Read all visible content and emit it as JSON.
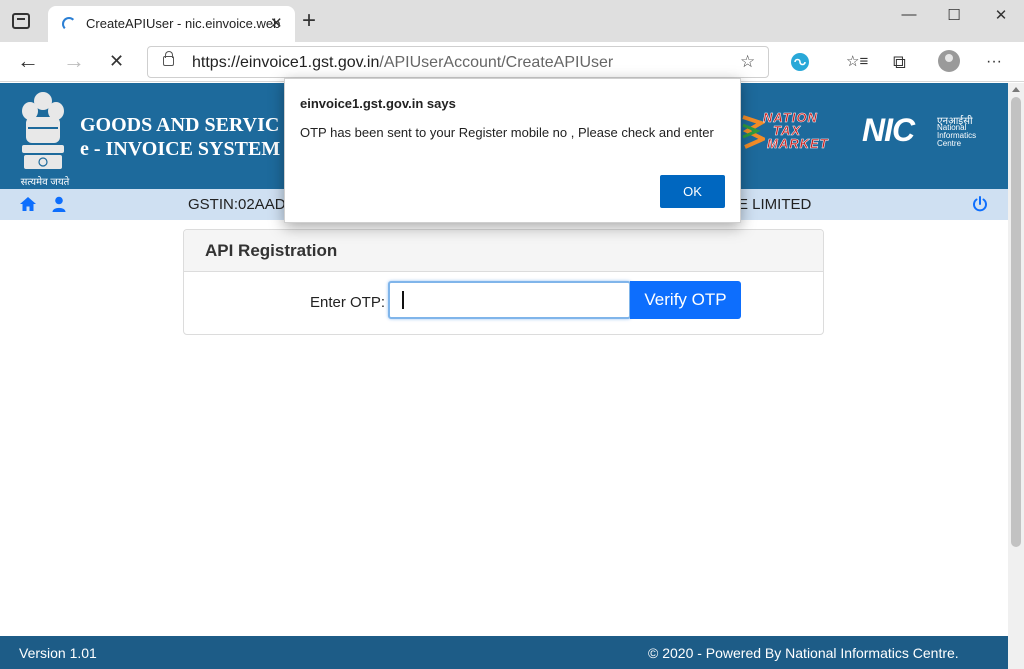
{
  "browser": {
    "tab_title": "CreateAPIUser - nic.einvoice.web",
    "tab_close": "✕",
    "new_tab": "+",
    "url_host": "https://einvoice1.gst.gov.in",
    "url_path": "/APIUserAccount/CreateAPIUser",
    "back": "←",
    "forward": "→",
    "stop": "✕",
    "minimize": "—",
    "maximize": "☐",
    "close": "✕",
    "favorite_icon": "☆",
    "favorites_icon": "☆≡",
    "collections_icon": "⧉",
    "menu_icon": "···"
  },
  "site": {
    "title_line1": "GOODS AND SERVIC",
    "title_line2": "e - INVOICE SYSTEM",
    "emblem_text": "सत्यमेव जयते",
    "ntm_lines": [
      "NATION",
      "TAX",
      "MARKET"
    ],
    "nic_letters": "NIC",
    "nic_hindi": "एनआईसी",
    "nic_english": "National Informatics Centre"
  },
  "nav": {
    "gstin": "GSTIN:02AAD",
    "company": "E LIMITED"
  },
  "card": {
    "title": "API Registration",
    "otp_label": "Enter OTP:",
    "otp_value": "",
    "verify_label": "Verify OTP"
  },
  "footer": {
    "version": "Version 1.01",
    "powered": "© 2020 - Powered By National Informatics Centre."
  },
  "dialog": {
    "title": "einvoice1.gst.gov.in says",
    "message": "OTP has been sent to your Register mobile no , Please check and enter",
    "ok_label": "OK"
  },
  "colors": {
    "header_blue": "#1d6a9c",
    "nav_strip": "#cfe0f2",
    "primary_button": "#0d6efd",
    "dialog_button": "#0067c0",
    "footer_blue": "#1d5c87"
  }
}
